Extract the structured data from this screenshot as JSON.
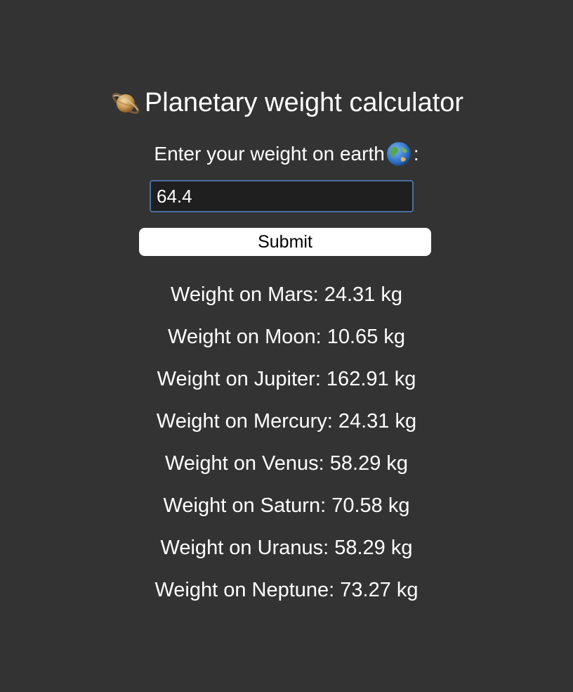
{
  "header": {
    "title_icon": "ringed-planet-icon",
    "title": "Planetary weight calculator"
  },
  "form": {
    "prompt_before": "Enter your weight on earth",
    "prompt_icon": "globe-icon",
    "prompt_after": ":",
    "input_value": "64.4",
    "submit_label": "Submit"
  },
  "results": [
    "Weight on Mars: 24.31 kg",
    "Weight on Moon: 10.65 kg",
    "Weight on Jupiter: 162.91 kg",
    "Weight on Mercury: 24.31 kg",
    "Weight on Venus: 58.29 kg",
    "Weight on Saturn: 70.58 kg",
    "Weight on Uranus: 58.29 kg",
    "Weight on Neptune: 73.27 kg"
  ],
  "colors": {
    "background": "#333333",
    "input_background": "#1f1f1f",
    "input_border": "#4a6da0",
    "button_background": "#ffffff"
  }
}
